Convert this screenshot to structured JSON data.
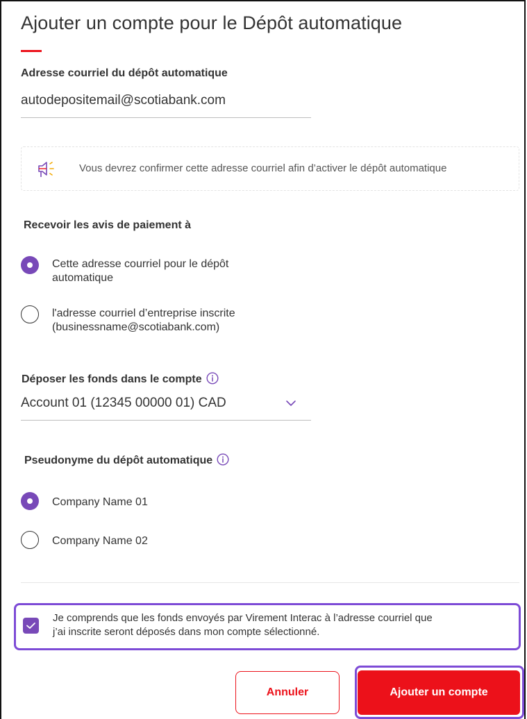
{
  "title": "Ajouter un compte pour le Dépôt automatique",
  "email_section": {
    "label": "Adresse courriel du dépôt automatique",
    "value": "autodepositemail@scotiabank.com"
  },
  "notice": {
    "icon": "megaphone-icon",
    "text": "Vous devrez confirmer cette adresse courriel afin d’activer le dépôt automatique"
  },
  "notifications": {
    "label": "Recevoir les avis de paiement à",
    "options": [
      {
        "line1": "Cette adresse courriel pour le dépôt",
        "line2": "automatique",
        "selected": true
      },
      {
        "line1": "l'adresse courriel d’entreprise inscrite",
        "line2": "(businessname@scotiabank.com)",
        "selected": false
      }
    ]
  },
  "deposit_account": {
    "label": "Déposer les fonds dans le compte",
    "selected": "Account 01 (12345 00000 01) CAD"
  },
  "alias": {
    "label": "Pseudonyme du dépôt automatique",
    "options": [
      {
        "label": "Company Name 01",
        "selected": true
      },
      {
        "label": "Company Name 02",
        "selected": false
      }
    ]
  },
  "consent": {
    "checked": true,
    "line1": "Je comprends que les fonds envoyés par Virement Interac à l’adresse courriel que",
    "line2": "j’ai inscrite seront déposés dans mon compte sélectionné."
  },
  "buttons": {
    "cancel": "Annuler",
    "submit": "Ajouter un compte"
  },
  "colors": {
    "brand_red": "#ec111a",
    "accent_purple": "#7849b8",
    "highlight_purple": "#7d4bd6"
  }
}
